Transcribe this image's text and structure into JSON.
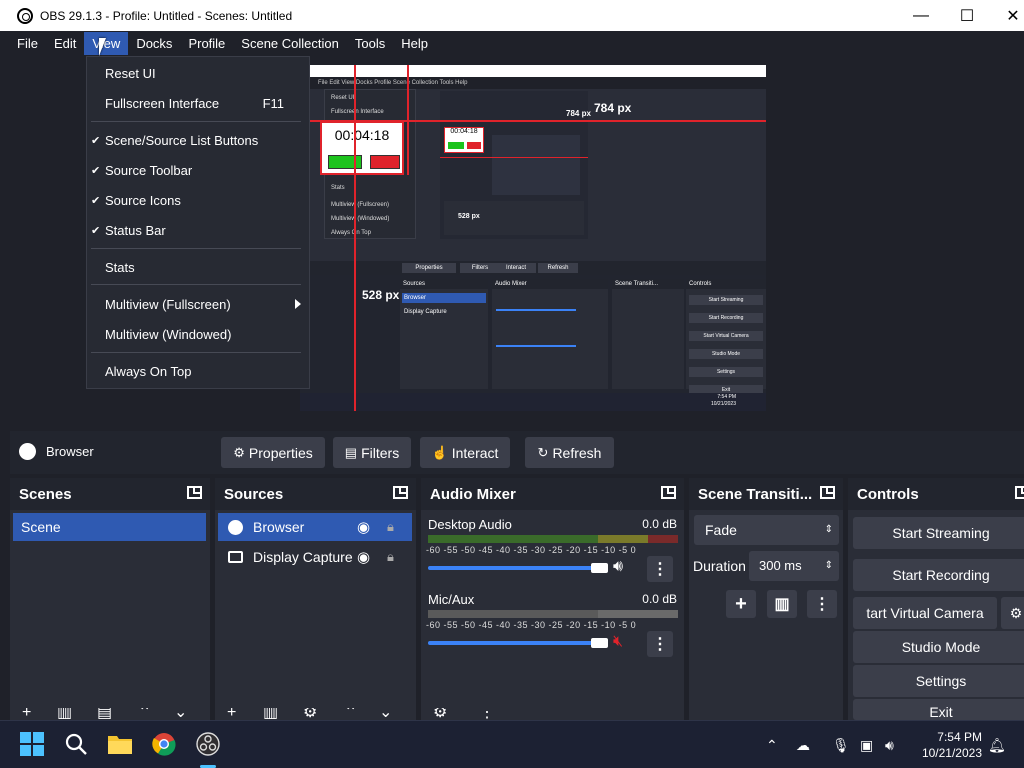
{
  "window": {
    "title": "OBS 29.1.3 - Profile: Untitled - Scenes: Untitled",
    "minimize": "—",
    "maximize": "☐",
    "close": "✕"
  },
  "menubar": {
    "items": [
      "File",
      "Edit",
      "View",
      "Docks",
      "Profile",
      "Scene Collection",
      "Tools",
      "Help"
    ],
    "active": "View"
  },
  "view_menu": {
    "items": [
      {
        "label": "Reset UI",
        "checked": false
      },
      {
        "label": "Fullscreen Interface",
        "shortcut": "F11",
        "checked": false
      },
      {
        "label": "Scene/Source List Buttons",
        "checked": true
      },
      {
        "label": "Source Toolbar",
        "checked": true
      },
      {
        "label": "Source Icons",
        "checked": true
      },
      {
        "label": "Status Bar",
        "checked": true
      },
      {
        "label": "Stats",
        "checked": false
      },
      {
        "label": "Multiview (Fullscreen)",
        "submenu": true,
        "checked": false
      },
      {
        "label": "Multiview (Windowed)",
        "checked": false
      },
      {
        "label": "Always On Top",
        "checked": false
      }
    ],
    "check_glyph": "✔"
  },
  "preview": {
    "width_label": "784 px",
    "height_label": "528 px",
    "timer": "00:04:18",
    "inner_width_label": "784 px",
    "inner_height_label": "528 px",
    "inner_timer": "00:04:18",
    "inner_menu": "File  Edit  View  Docks  Profile  Scene Collection  Tools  Help",
    "inner_menu_items": [
      "Reset UI",
      "Fullscreen Interface",
      "Stats",
      "Multiview (Fullscreen)",
      "Multiview (Windowed)",
      "Always On Top"
    ],
    "inner_toolbar": [
      "Properties",
      "Filters",
      "Interact",
      "Refresh"
    ],
    "inner_sources": [
      "Browser",
      "Display Capture"
    ],
    "inner_docks": [
      "Sources",
      "Audio Mixer",
      "Scene Transiti...",
      "Controls"
    ],
    "inner_controls": [
      "Start Streaming",
      "Start Recording",
      "Start Virtual Camera",
      "Studio Mode",
      "Settings",
      "Exit"
    ],
    "inner_time": "7:54 PM",
    "inner_date": "10/21/2023"
  },
  "source_toolbar": {
    "selected_source": "Browser",
    "buttons": [
      {
        "label": "Properties",
        "icon": "gear-icon"
      },
      {
        "label": "Filters",
        "icon": "filter-icon"
      },
      {
        "label": "Interact",
        "icon": "pointer-icon"
      },
      {
        "label": "Refresh",
        "icon": "refresh-icon"
      }
    ]
  },
  "scenes": {
    "title": "Scenes",
    "items": [
      "Scene"
    ]
  },
  "sources": {
    "title": "Sources",
    "items": [
      {
        "label": "Browser",
        "icon": "globe-icon",
        "selected": true
      },
      {
        "label": "Display Capture",
        "icon": "monitor-icon",
        "selected": false
      }
    ]
  },
  "audio_mixer": {
    "title": "Audio Mixer",
    "scale": "-60 -55 -50 -45 -40 -35 -30 -25 -20 -15 -10 -5 0",
    "channels": [
      {
        "name": "Desktop Audio",
        "db": "0.0 dB",
        "muted": false,
        "level": 1.0
      },
      {
        "name": "Mic/Aux",
        "db": "0.0 dB",
        "muted": true,
        "level": 1.0
      }
    ]
  },
  "transitions": {
    "title": "Scene Transiti...",
    "selected": "Fade",
    "duration_label": "Duration",
    "duration_value": "300 ms"
  },
  "controls": {
    "title": "Controls",
    "buttons": [
      "Start Streaming",
      "Start Recording",
      "Start Virtual Camera",
      "Studio Mode",
      "Settings",
      "Exit"
    ],
    "virtual_camera_visible": "tart Virtual Camera"
  },
  "taskbar": {
    "time": "7:54 PM",
    "date": "10/21/2023"
  },
  "colors": {
    "accent": "#2f5ab2",
    "background": "#1f2129",
    "panel": "#2a2d37",
    "button": "#3b3e4a",
    "red": "#e0232b"
  }
}
